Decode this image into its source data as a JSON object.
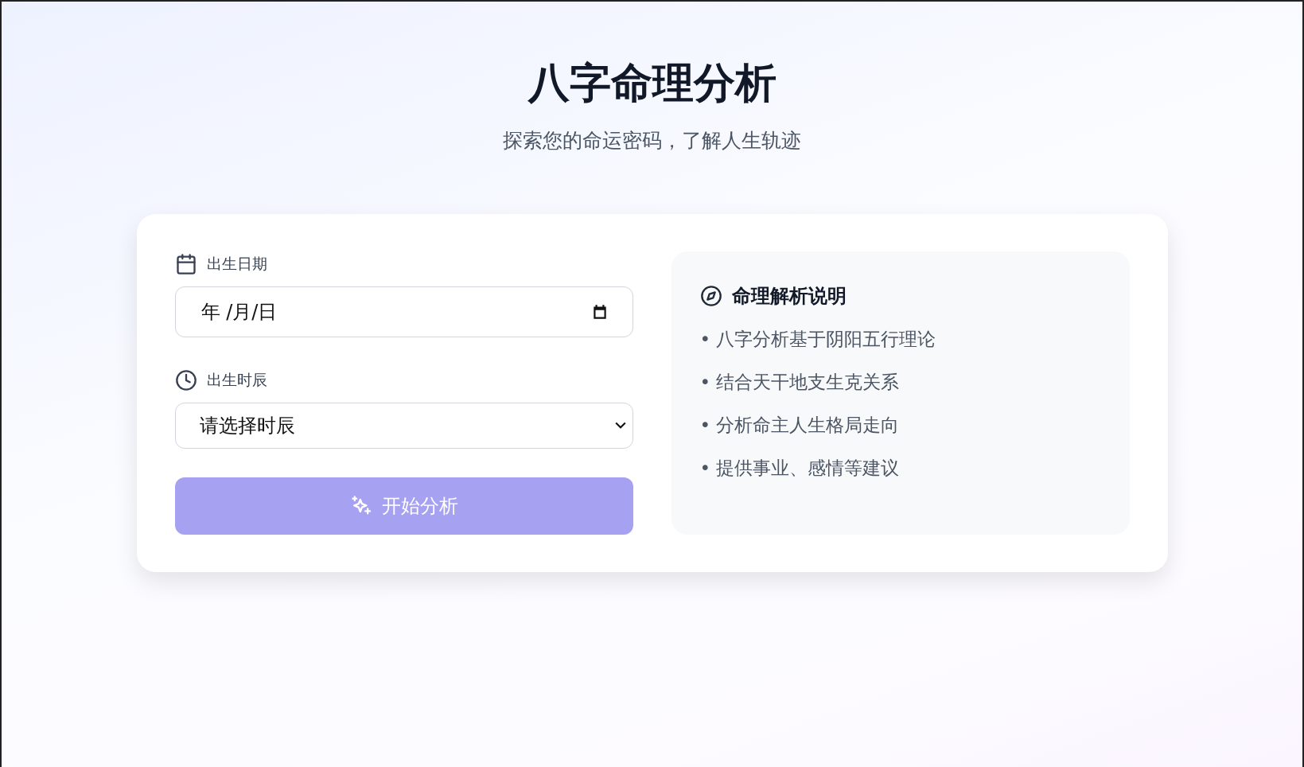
{
  "header": {
    "title": "八字命理分析",
    "subtitle": "探索您的命运密码，了解人生轨迹"
  },
  "form": {
    "date_field": {
      "label": "出生日期",
      "placeholder": "年 /月/日"
    },
    "time_field": {
      "label": "出生时辰",
      "value": "请选择时辰"
    },
    "submit_button": {
      "label": "开始分析",
      "disabled": true
    }
  },
  "info_panel": {
    "title": "命理解析说明",
    "items": [
      "• 八字分析基于阴阳五行理论",
      "• 结合天干地支生克关系",
      "• 分析命主人生格局走向",
      "• 提供事业、感情等建议"
    ]
  }
}
